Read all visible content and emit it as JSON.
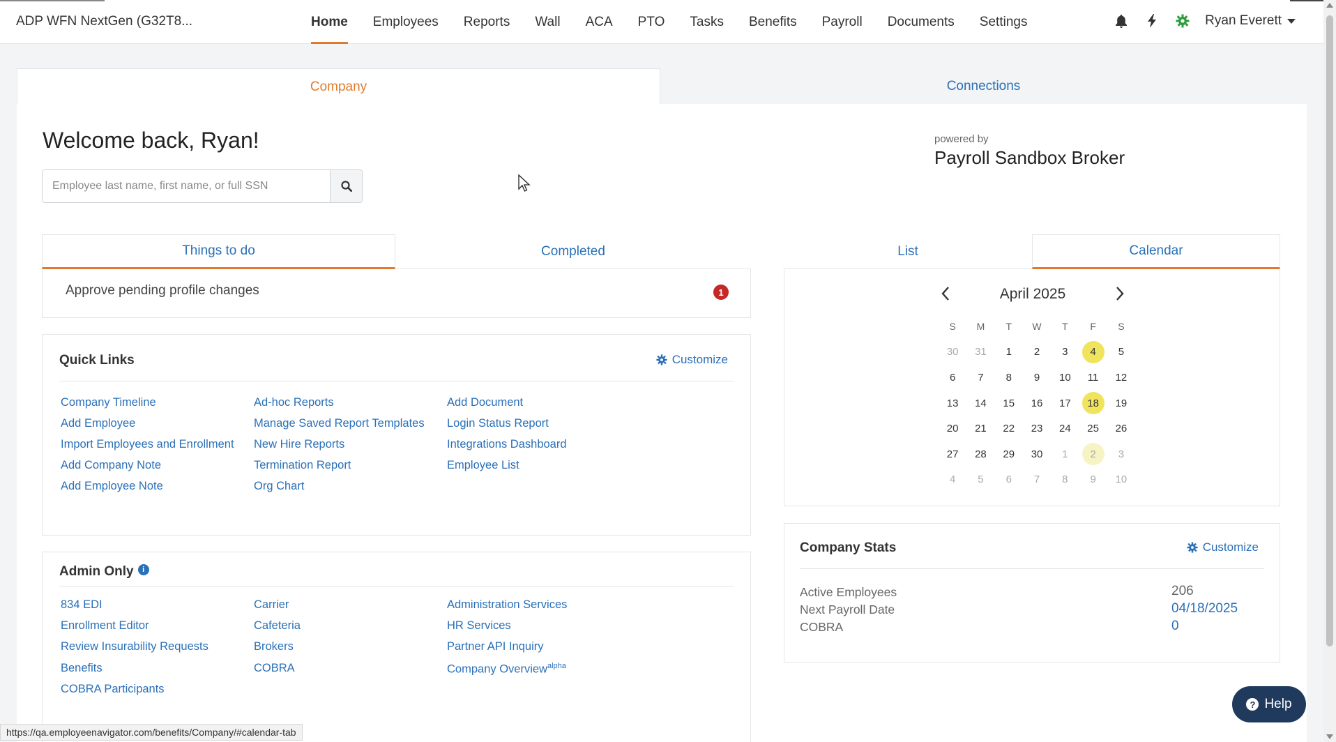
{
  "app": {
    "title": "ADP WFN NextGen (G32T8..."
  },
  "nav": {
    "items": [
      "Home",
      "Employees",
      "Reports",
      "Wall",
      "ACA",
      "PTO",
      "Tasks",
      "Benefits",
      "Payroll",
      "Documents",
      "Settings"
    ],
    "active": "Home"
  },
  "user": {
    "name": "Ryan Everett"
  },
  "main_tabs": {
    "company": "Company",
    "connections": "Connections"
  },
  "welcome": {
    "heading": "Welcome back, Ryan!"
  },
  "search": {
    "placeholder": "Employee last name, first name, or full SSN",
    "value": ""
  },
  "broker": {
    "powered_by": "powered by",
    "name": "Payroll Sandbox Broker"
  },
  "todo": {
    "tabs": {
      "things": "Things to do",
      "completed": "Completed"
    },
    "items": [
      {
        "label": "Approve pending profile changes",
        "count": "1"
      }
    ]
  },
  "quick_links": {
    "title": "Quick Links",
    "customize": "Customize",
    "columns": [
      [
        "Company Timeline",
        "Add Employee",
        "Import Employees and Enrollment",
        "Add Company Note",
        "Add Employee Note"
      ],
      [
        "Ad-hoc Reports",
        "Manage Saved Report Templates",
        "New Hire Reports",
        "Termination Report",
        "Org Chart"
      ],
      [
        "Add Document",
        "Login Status Report",
        "Integrations Dashboard",
        "Employee List"
      ]
    ]
  },
  "admin_only": {
    "title": "Admin Only",
    "info_icon": "i",
    "columns": [
      [
        "834 EDI",
        "Enrollment Editor",
        "Review Insurability Requests",
        "Benefits",
        "COBRA Participants"
      ],
      [
        "Carrier",
        "Cafeteria",
        "Brokers",
        "COBRA"
      ],
      [
        "Administration Services",
        "HR Services",
        "Partner API Inquiry",
        "Company Overview"
      ]
    ],
    "company_overview_sup": "alpha"
  },
  "calendar": {
    "tabs": {
      "list": "List",
      "calendar": "Calendar"
    },
    "month": "April 2025",
    "weekdays": [
      "S",
      "M",
      "T",
      "W",
      "T",
      "F",
      "S"
    ],
    "weeks": [
      [
        [
          "30",
          "muted"
        ],
        [
          "31",
          "muted"
        ],
        [
          "1",
          ""
        ],
        [
          "2",
          ""
        ],
        [
          "3",
          ""
        ],
        [
          "4",
          "hl"
        ],
        [
          "5",
          ""
        ]
      ],
      [
        [
          "6",
          ""
        ],
        [
          "7",
          ""
        ],
        [
          "8",
          ""
        ],
        [
          "9",
          ""
        ],
        [
          "10",
          ""
        ],
        [
          "11",
          ""
        ],
        [
          "12",
          ""
        ]
      ],
      [
        [
          "13",
          ""
        ],
        [
          "14",
          ""
        ],
        [
          "15",
          ""
        ],
        [
          "16",
          ""
        ],
        [
          "17",
          ""
        ],
        [
          "18",
          "hl"
        ],
        [
          "19",
          ""
        ]
      ],
      [
        [
          "20",
          ""
        ],
        [
          "21",
          ""
        ],
        [
          "22",
          ""
        ],
        [
          "23",
          ""
        ],
        [
          "24",
          ""
        ],
        [
          "25",
          ""
        ],
        [
          "26",
          ""
        ]
      ],
      [
        [
          "27",
          ""
        ],
        [
          "28",
          ""
        ],
        [
          "29",
          ""
        ],
        [
          "30",
          ""
        ],
        [
          "1",
          "muted"
        ],
        [
          "2",
          "muted hl-light"
        ],
        [
          "3",
          "muted"
        ]
      ],
      [
        [
          "4",
          "muted"
        ],
        [
          "5",
          "muted"
        ],
        [
          "6",
          "muted"
        ],
        [
          "7",
          "muted"
        ],
        [
          "8",
          "muted"
        ],
        [
          "9",
          "muted"
        ],
        [
          "10",
          "muted"
        ]
      ]
    ]
  },
  "company_stats": {
    "title": "Company Stats",
    "customize": "Customize",
    "rows": [
      {
        "label": "Active Employees",
        "value": "206",
        "link": false
      },
      {
        "label": "Next Payroll Date",
        "value": "04/18/2025",
        "link": true
      },
      {
        "label": "COBRA",
        "value": "0",
        "link": true
      }
    ]
  },
  "status_url": "https://qa.employeenavigator.com/benefits/Company/#calendar-tab",
  "help": {
    "label": "Help",
    "icon": "?"
  },
  "colors": {
    "accent": "#e07b2e",
    "link": "#2a70b8",
    "highlight": "#f0e45c",
    "badge": "#c62828",
    "help_bg": "#1f3a5c"
  }
}
